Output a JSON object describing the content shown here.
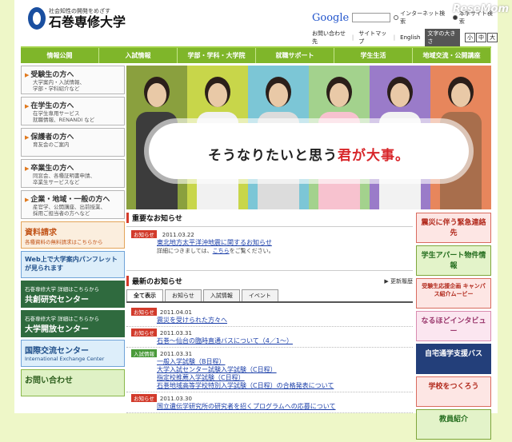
{
  "header": {
    "logo_tagline": "社会知性の開発をめざす",
    "logo_name": "石巻専修大学",
    "search_brand": "Google",
    "search_placeholder": "",
    "radio_internet": "インターネット検索",
    "radio_site": "本学サイト検索",
    "watermark": "ReseMom",
    "contact": "お問い合わせ先",
    "sitemap": "サイトマップ",
    "english": "English",
    "font_size_label": "文字の大きさ",
    "font_sizes": [
      "小",
      "中",
      "大"
    ]
  },
  "nav": [
    "情報公開",
    "入試情報",
    "学部・学科・大学院",
    "就職サポート",
    "学生生活",
    "地域交流・公開講座"
  ],
  "sidebar": {
    "items": [
      {
        "title": "受験生の方へ",
        "sub": [
          "大学案内・入試情報、",
          "学部・学科紹介など"
        ]
      },
      {
        "title": "在学生の方へ",
        "sub": [
          "在学生専用サービス",
          "就職情報、RENANDI など"
        ]
      },
      {
        "title": "保護者の方へ",
        "sub": [
          "育友会のご案内"
        ]
      },
      {
        "title": "卒業生の方へ",
        "sub": [
          "同窓会、各種証明書申請、",
          "卒業生サービスなど"
        ]
      },
      {
        "title": "企業・地域・一般の方へ",
        "sub": [
          "産官学、公開講座、出前授業、",
          "採用ご担当者の方へなど"
        ]
      }
    ],
    "banners": [
      {
        "title": "資料請求",
        "sub": "各種資料の無料請求はこちらから"
      },
      {
        "title": "Web上で大学案内パンフレットが見られます",
        "sub": ""
      },
      {
        "title": "共創研究センター",
        "sub": "石巻専修大学 詳細はこちらから"
      },
      {
        "title": "大学開放センター",
        "sub": "石巻専修大学 詳細はこちらから"
      },
      {
        "title": "国際交流センター",
        "sub": "International Exchange Center"
      },
      {
        "title": "お問い合わせ",
        "sub": ""
      }
    ]
  },
  "hero": {
    "slogan_pre": "そうなりたいと思う",
    "slogan_hl": "君が大事。"
  },
  "important": {
    "title": "重要なお知らせ",
    "badge": "お知らせ",
    "date": "2011.03.22",
    "link": "東北地方太平洋沖地震に関するお知らせ",
    "note_pre": "詳細につきましては、",
    "note_link": "こちら",
    "note_post": "をご覧ください。"
  },
  "news": {
    "title": "最新のお知らせ",
    "more": "更新履歴",
    "tabs": [
      "全て表示",
      "お知らせ",
      "入試情報",
      "イベント"
    ],
    "items": [
      {
        "badge": "お知らせ",
        "date": "2011.04.01",
        "links": [
          "震災を受けられた方々へ"
        ]
      },
      {
        "badge": "お知らせ",
        "date": "2011.03.31",
        "links": [
          "石巻〜仙台の臨時直通バスについて（4／1〜）"
        ]
      },
      {
        "badge": "入試情報",
        "date": "2011.03.31",
        "links": [
          "一般入学試験（B日程）",
          "大学入試センター試験入学試験（C日程）",
          "指定校推薦入学試験（C日程）",
          "石巻地域高等学校特別入学試験（C日程）の合格発表について"
        ]
      },
      {
        "badge": "お知らせ",
        "date": "2011.03.30",
        "links": [
          "国立遺伝学研究所の研究者を招くプログラムへの応募について"
        ]
      }
    ]
  },
  "right": [
    {
      "title": "震災に伴う緊急連絡先"
    },
    {
      "title": "学生アパート物件情報"
    },
    {
      "title": "受験生応援企画 キャンパス紹介ムービー"
    },
    {
      "title": "なるほどインタビュー"
    },
    {
      "title": "自宅通学支援バス"
    },
    {
      "title": "学校をつくろう"
    },
    {
      "title": "教員紹介"
    }
  ],
  "colors": {
    "nav": "#7fb62a",
    "accent_red": "#d23a2b",
    "page_bg": "#eef7c8"
  }
}
